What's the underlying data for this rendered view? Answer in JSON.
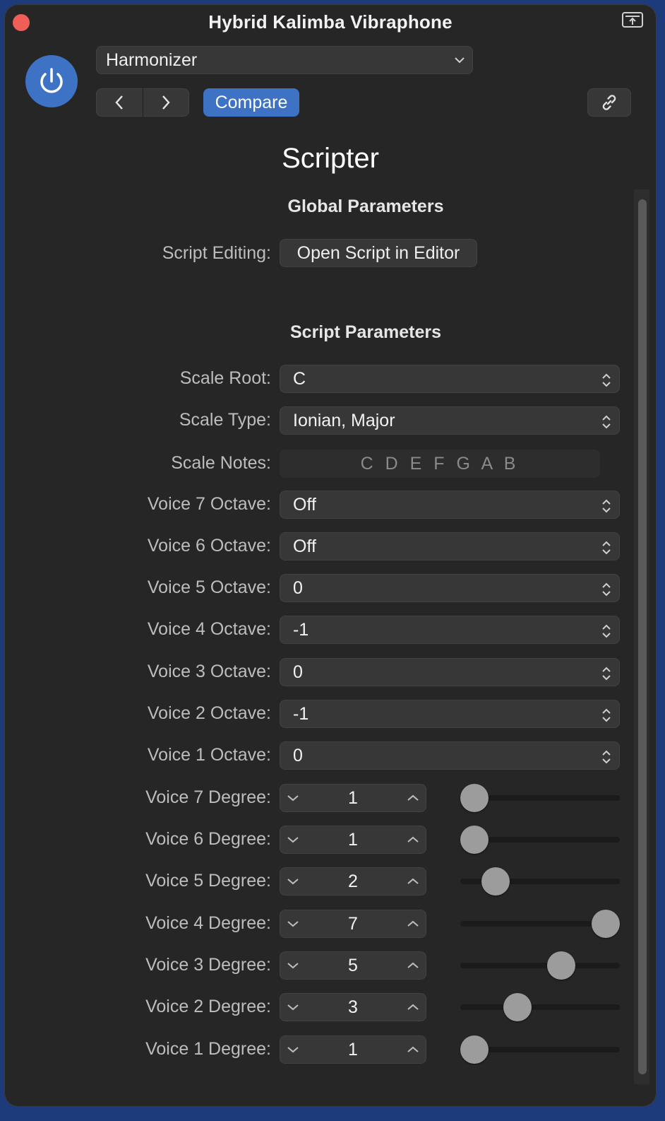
{
  "window": {
    "title": "Hybrid Kalimba Vibraphone"
  },
  "header": {
    "preset": "Harmonizer",
    "compare_label": "Compare"
  },
  "plugin": {
    "name": "Scripter",
    "global_section": "Global Parameters",
    "script_editing_label": "Script Editing:",
    "open_editor_label": "Open Script in Editor",
    "script_section": "Script Parameters"
  },
  "params": {
    "scale_root": {
      "label": "Scale Root:",
      "value": "C"
    },
    "scale_type": {
      "label": "Scale Type:",
      "value": "Ionian, Major"
    },
    "scale_notes": {
      "label": "Scale Notes:",
      "value": "C D E F G A B"
    },
    "octaves": [
      {
        "label": "Voice 7 Octave:",
        "value": "Off"
      },
      {
        "label": "Voice 6 Octave:",
        "value": "Off"
      },
      {
        "label": "Voice 5 Octave:",
        "value": "0"
      },
      {
        "label": "Voice 4 Octave:",
        "value": "-1"
      },
      {
        "label": "Voice 3 Octave:",
        "value": "0"
      },
      {
        "label": "Voice 2 Octave:",
        "value": "-1"
      },
      {
        "label": "Voice 1 Octave:",
        "value": "0"
      }
    ],
    "degrees": [
      {
        "label": "Voice 7 Degree:",
        "value": "1",
        "slider_fraction": 0.0
      },
      {
        "label": "Voice 6 Degree:",
        "value": "1",
        "slider_fraction": 0.0
      },
      {
        "label": "Voice 5 Degree:",
        "value": "2",
        "slider_fraction": 0.16
      },
      {
        "label": "Voice 4 Degree:",
        "value": "7",
        "slider_fraction": 1.0
      },
      {
        "label": "Voice 3 Degree:",
        "value": "5",
        "slider_fraction": 0.66
      },
      {
        "label": "Voice 2 Degree:",
        "value": "3",
        "slider_fraction": 0.33
      },
      {
        "label": "Voice 1 Degree:",
        "value": "1",
        "slider_fraction": 0.0
      }
    ]
  },
  "colors": {
    "accent": "#3d72c4",
    "close": "#ef5f57",
    "background": "#262626"
  }
}
